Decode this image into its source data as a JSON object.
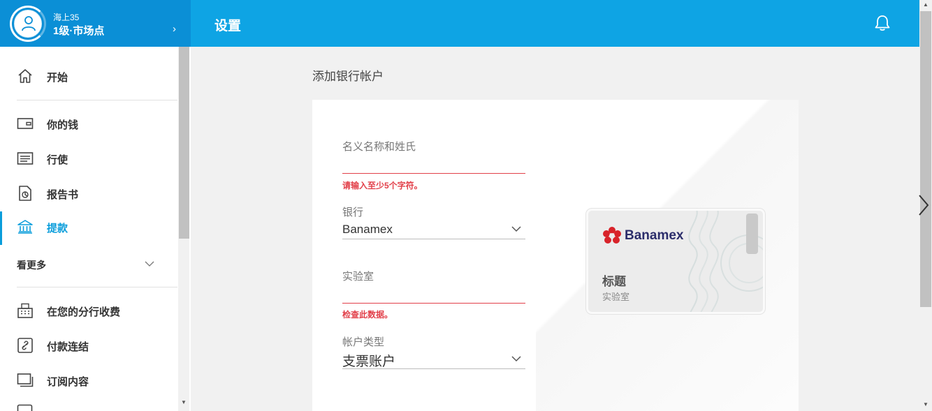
{
  "profile": {
    "name": "海上35",
    "level": "1级·市场点",
    "chevron": "›"
  },
  "header": {
    "title": "设置"
  },
  "sidebar": {
    "items": [
      {
        "label": "开始",
        "icon": "home-icon"
      },
      {
        "label": "你的钱",
        "icon": "wallet-icon"
      },
      {
        "label": "行使",
        "icon": "list-icon"
      },
      {
        "label": "报告书",
        "icon": "report-icon"
      },
      {
        "label": "提款",
        "icon": "bank-icon",
        "active": true
      },
      {
        "label": "在您的分行收费",
        "icon": "register-icon"
      },
      {
        "label": "付款连结",
        "icon": "link-icon"
      },
      {
        "label": "订阅内容",
        "icon": "subscription-icon"
      }
    ],
    "see_more": "看更多"
  },
  "main": {
    "section_title": "添加银行帐户",
    "form": {
      "holder_label": "名义名称和姓氏",
      "holder_error": "请输入至少5个字符。",
      "bank_label": "银行",
      "bank_value": "Banamex",
      "lab_label": "实验室",
      "lab_error": "检查此数据。",
      "account_type_label": "帐户类型",
      "account_type_value": "支票账户"
    },
    "card": {
      "bank_name": "Banamex",
      "title": "标题",
      "subtitle": "实验室"
    }
  },
  "colors": {
    "primary": "#0ea4e4",
    "profile_bg": "#0b8fd6",
    "error": "#e2404a",
    "banamex_red": "#d8232a"
  }
}
